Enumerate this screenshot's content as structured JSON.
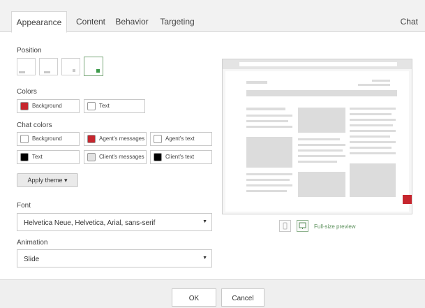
{
  "tabs": [
    "Appearance",
    "Content",
    "Behavior",
    "Targeting"
  ],
  "header_right": "Chat",
  "position": {
    "label": "Position",
    "options": [
      "bottom-left-corner",
      "bottom-left",
      "bottom-right",
      "bottom-right-corner"
    ],
    "selected": "bottom-right-corner"
  },
  "colors": {
    "label": "Colors",
    "background_label": "Background",
    "background_color": "#c6262e",
    "text_label": "Text",
    "text_color": "#ffffff"
  },
  "chat_colors": {
    "label": "Chat colors",
    "items": [
      {
        "label": "Background",
        "color": "#ffffff"
      },
      {
        "label": "Agent's messages",
        "color": "#c6262e"
      },
      {
        "label": "Agent's text",
        "color": "#ffffff"
      },
      {
        "label": "Text",
        "color": "#000000"
      },
      {
        "label": "Client's messages",
        "color": "#e2e2e2"
      },
      {
        "label": "Client's text",
        "color": "#000000"
      }
    ]
  },
  "apply_theme": "Apply theme ▾",
  "font": {
    "label": "Font",
    "value": "Helvetica Neue, Helvetica, Arial, sans-serif"
  },
  "animation": {
    "label": "Animation",
    "value": "Slide"
  },
  "preview": {
    "mobile_icon": "mobile-icon",
    "desktop_icon": "monitor-icon",
    "full_size_label": "Full-size preview",
    "accent": "#c6262e"
  },
  "footer": {
    "ok": "OK",
    "cancel": "Cancel"
  }
}
